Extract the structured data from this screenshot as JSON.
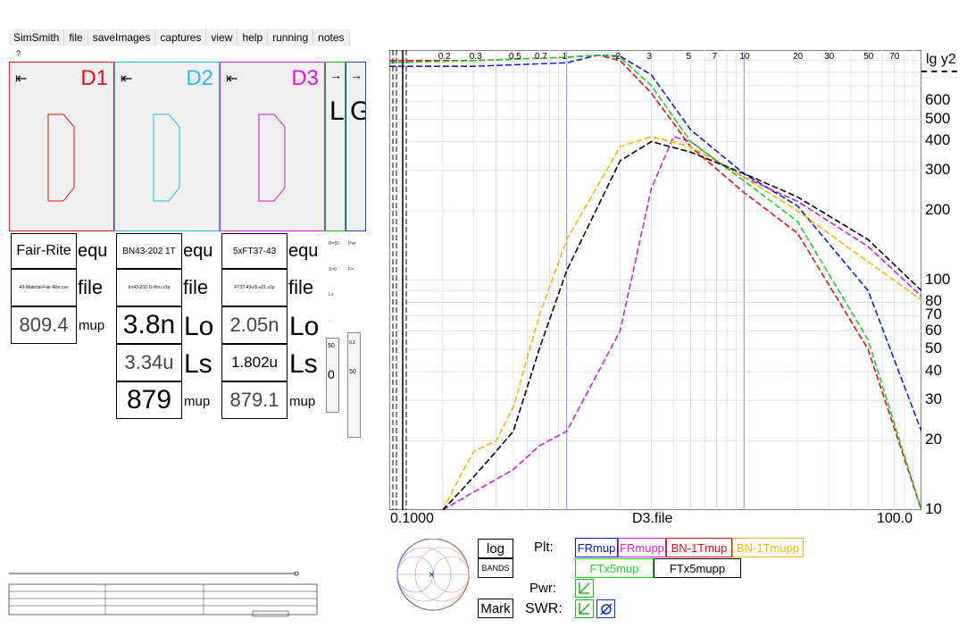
{
  "menu": [
    "SimSmith",
    "file",
    "saveImages",
    "captures",
    "view",
    "help",
    "running",
    "notes"
  ],
  "help_mark": "?",
  "panels": [
    {
      "title": "D1",
      "color": "#e01010",
      "arrow": "⇤"
    },
    {
      "title": "D2",
      "color": "#30b8e8",
      "arrow": "⇤"
    },
    {
      "title": "D3",
      "color": "#e010e0",
      "arrow": "⇤"
    }
  ],
  "narrow_panels": [
    {
      "arrow": "→",
      "letter": "L",
      "color": "#20b020"
    },
    {
      "arrow": "→",
      "letter": "G",
      "color": "#2040c0"
    }
  ],
  "d1": {
    "name": "Fair-Rite",
    "name_label": "equ",
    "file": "43-Material-Fair-Rite.csv",
    "file_label": "file",
    "value": "809.4",
    "value_label": "mup"
  },
  "d2": {
    "name": "BN43-202 1T",
    "name_label": "equ",
    "file": "bn43-202-1t-thru.s1p",
    "file_label": "file",
    "lo": "3.8n",
    "lo_label": "Lo",
    "ls": "3.34u",
    "ls_label": "Ls",
    "mup": "879",
    "mup_label": "mup"
  },
  "d3": {
    "name": "5xFT37-43",
    "name_label": "equ",
    "file": "FT37-43-x5-s21.s1p",
    "file_label": "file",
    "lo": "2.05n",
    "lo_label": "Lo",
    "ls": "1.802u",
    "ls_label": "Ls",
    "mup": "879.1",
    "mup_label": "mup"
  },
  "mini_params": [
    "R=50",
    "Pwr",
    "X=0",
    "F=",
    "Lx",
    "..."
  ],
  "sliders": {
    "a_top": "50",
    "a_mid": "0",
    "b_top": "0.1",
    "b_mid": "50"
  },
  "chart": {
    "y_label": "lg y2",
    "y_ticks": [
      "600",
      "500",
      "400",
      "300",
      "200",
      "100",
      "80",
      "70",
      "60",
      "50",
      "40",
      "30",
      "20",
      "10"
    ],
    "x_top_ticks": [
      "0.2",
      "0.3",
      "0.5",
      "0.7",
      "1",
      "2",
      "3",
      "5",
      "7",
      "10",
      "20",
      "30",
      "50",
      "70"
    ],
    "x_left": "0.1000",
    "x_mid": "D3.file",
    "x_right": "100.0"
  },
  "chart_data": {
    "type": "line",
    "xlabel": "D3.file",
    "ylabel": "lg y2",
    "x_scale": "log",
    "y_scale": "log",
    "xlim": [
      0.1,
      100
    ],
    "ylim": [
      10,
      1000
    ],
    "series": [
      {
        "name": "FRmup",
        "color": "#1020c0",
        "x": [
          0.1,
          0.3,
          1,
          1.5,
          2,
          3,
          5,
          10,
          20,
          50,
          100
        ],
        "y": [
          850,
          850,
          880,
          950,
          940,
          780,
          450,
          290,
          210,
          90,
          22
        ]
      },
      {
        "name": "FRmupp",
        "color": "#d020d0",
        "x": [
          0.2,
          0.3,
          0.5,
          0.7,
          1,
          2,
          3,
          4,
          5,
          7,
          10,
          20,
          50,
          100
        ],
        "y": [
          10,
          12,
          15,
          19,
          22,
          60,
          250,
          420,
          400,
          330,
          280,
          220,
          140,
          85
        ]
      },
      {
        "name": "BN-1Tmup",
        "color": "#e01010",
        "x": [
          0.1,
          0.3,
          1,
          1.5,
          2,
          3,
          5,
          10,
          20,
          50,
          100
        ],
        "y": [
          900,
          900,
          930,
          950,
          900,
          650,
          380,
          240,
          160,
          50,
          10
        ]
      },
      {
        "name": "BN-1Tmupp",
        "color": "#f0b800",
        "x": [
          0.2,
          0.25,
          0.3,
          0.4,
          0.5,
          0.7,
          1,
          2,
          3,
          5,
          10,
          20,
          50,
          100
        ],
        "y": [
          10,
          14,
          18,
          20,
          28,
          70,
          150,
          380,
          420,
          380,
          280,
          200,
          120,
          82
        ]
      },
      {
        "name": "FTx5mup",
        "color": "#20d020",
        "x": [
          0.1,
          0.3,
          1,
          1.5,
          2,
          3,
          5,
          10,
          20,
          50,
          100
        ],
        "y": [
          880,
          900,
          930,
          950,
          930,
          700,
          400,
          270,
          180,
          55,
          10
        ]
      },
      {
        "name": "FTx5mupp",
        "color": "#000000",
        "x": [
          0.2,
          0.25,
          0.3,
          0.4,
          0.5,
          0.7,
          1,
          2,
          3,
          5,
          10,
          20,
          50,
          100
        ],
        "y": [
          10,
          12,
          14,
          18,
          22,
          50,
          110,
          330,
          400,
          360,
          290,
          230,
          150,
          90
        ]
      }
    ]
  },
  "controls": {
    "log": "log",
    "bands": "BANDS",
    "mark": "Mark",
    "plt": "Plt:",
    "pwr": "Pwr:",
    "swr": "SWR:"
  },
  "plt_buttons": [
    {
      "label": "FRmup",
      "color": "#1020c0"
    },
    {
      "label": "FRmupp",
      "color": "#d020d0"
    },
    {
      "label": "BN-1Tmup",
      "color": "#e01010"
    },
    {
      "label": "BN-1Tmupp",
      "color": "#f0b800"
    },
    {
      "label": "FTx5mup",
      "color": "#20d020"
    },
    {
      "label": "FTx5mupp",
      "color": "#000000"
    }
  ]
}
